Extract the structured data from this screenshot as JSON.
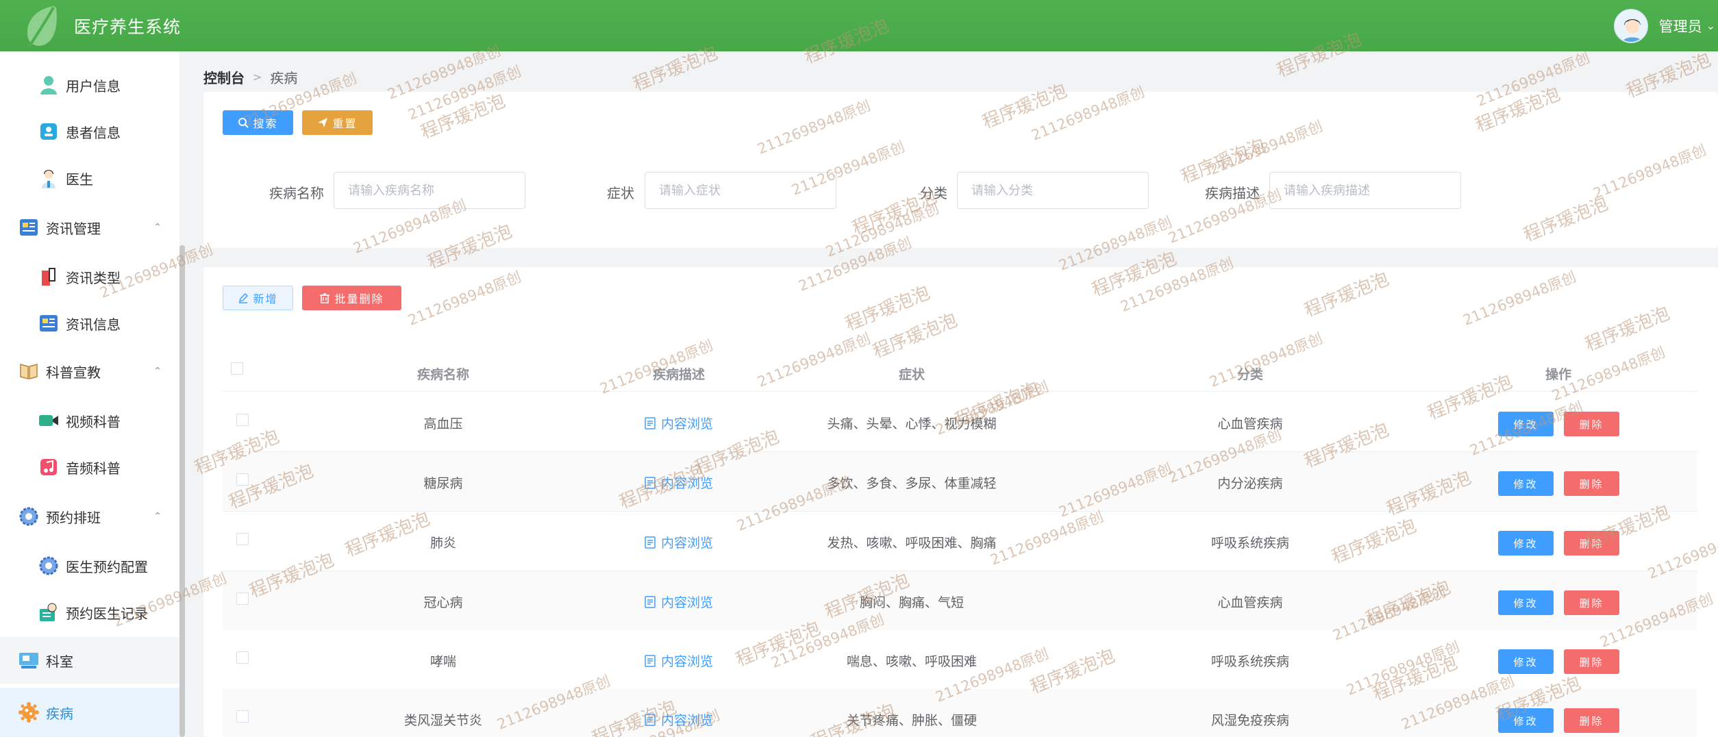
{
  "header": {
    "app_title": "医疗养生系统",
    "user_name": "管理员",
    "brand_color": "#4cae4c"
  },
  "sidebar": {
    "items": [
      {
        "label": "用户信息",
        "icon": "user-icon",
        "level": "sub"
      },
      {
        "label": "患者信息",
        "icon": "id-card-icon",
        "level": "sub"
      },
      {
        "label": "医生",
        "icon": "doctor-icon",
        "level": "sub"
      },
      {
        "label": "资讯管理",
        "icon": "news-icon",
        "level": "group",
        "expanded": true
      },
      {
        "label": "资讯类型",
        "icon": "book-icon",
        "level": "sub"
      },
      {
        "label": "资讯信息",
        "icon": "news-icon",
        "level": "sub"
      },
      {
        "label": "科普宣教",
        "icon": "book-open-icon",
        "level": "group",
        "expanded": true
      },
      {
        "label": "视频科普",
        "icon": "video-icon",
        "level": "sub"
      },
      {
        "label": "音频科普",
        "icon": "music-icon",
        "level": "sub"
      },
      {
        "label": "预约排班",
        "icon": "gear-icon",
        "level": "group",
        "expanded": true
      },
      {
        "label": "医生预约配置",
        "icon": "gear-icon",
        "level": "sub"
      },
      {
        "label": "预约医生记录",
        "icon": "doctor-record-icon",
        "level": "sub"
      },
      {
        "label": "科室",
        "icon": "department-icon",
        "level": "group"
      },
      {
        "label": "疾病",
        "icon": "disease-icon",
        "level": "group",
        "active": true
      }
    ]
  },
  "breadcrumb": {
    "home": "控制台",
    "current": "疾病"
  },
  "search": {
    "search_label": "搜索",
    "reset_label": "重置",
    "fields": [
      {
        "label": "疾病名称",
        "placeholder": "请输入疾病名称"
      },
      {
        "label": "症状",
        "placeholder": "请输入症状"
      },
      {
        "label": "分类",
        "placeholder": "请输入分类"
      },
      {
        "label": "疾病描述",
        "placeholder": "请输入疾病描述"
      }
    ]
  },
  "toolbar": {
    "add_label": "新增",
    "batch_delete_label": "批量删除"
  },
  "table": {
    "columns": [
      "疾病名称",
      "疾病描述",
      "症状",
      "分类",
      "操作"
    ],
    "rows": [
      {
        "name": "高血压",
        "desc": "内容浏览",
        "symptoms": "头痛、头晕、心悸、视力模糊",
        "category": "心血管疾病"
      },
      {
        "name": "糖尿病",
        "desc": "内容浏览",
        "symptoms": "多饮、多食、多尿、体重减轻",
        "category": "内分泌疾病"
      },
      {
        "name": "肺炎",
        "desc": "内容浏览",
        "symptoms": "发热、咳嗽、呼吸困难、胸痛",
        "category": "呼吸系统疾病"
      },
      {
        "name": "冠心病",
        "desc": "内容浏览",
        "symptoms": "胸闷、胸痛、气短",
        "category": "心血管疾病"
      },
      {
        "name": "哮喘",
        "desc": "内容浏览",
        "symptoms": "喘息、咳嗽、呼吸困难",
        "category": "呼吸系统疾病"
      },
      {
        "name": "类风湿关节炎",
        "desc": "内容浏览",
        "symptoms": "关节疼痛、肿胀、僵硬",
        "category": "风湿免疫疾病"
      }
    ],
    "edit_label": "修改",
    "delete_label": "删除"
  },
  "watermark": {
    "text_a": "程序瑗泡泡",
    "text_b": "2112698948原创"
  }
}
